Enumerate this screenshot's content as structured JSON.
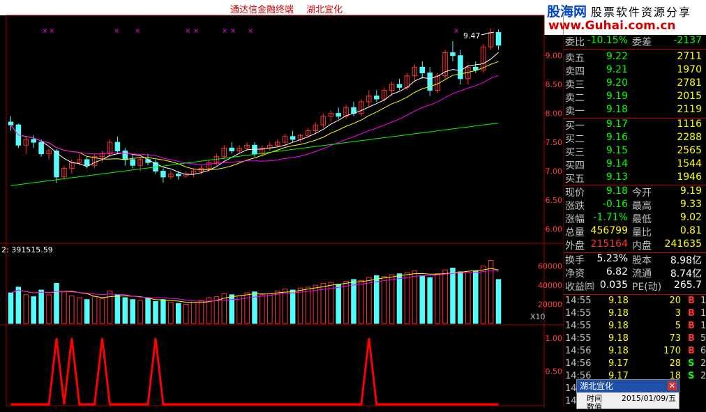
{
  "header": {
    "app_title": "通达信金融终端",
    "stock_name": "湖北宜化"
  },
  "logo": {
    "brand": "股海网",
    "tagline": "股票软件资源分享",
    "url": "www.Guhai.com.cn"
  },
  "price_axis": [
    "9.00",
    "8.50",
    "8.00",
    "7.50",
    "7.00",
    "6.50",
    "6.00"
  ],
  "volume_axis": [
    "60000",
    "40000",
    "20000"
  ],
  "volume_label": "2: 391515.59",
  "volume_unit": "X10",
  "signal_axis": [
    "1.00",
    "0.50"
  ],
  "high_marker": "9.47",
  "quote": {
    "webi_label": "委比",
    "webi_value": "-10.15%",
    "weicha_label": "委差",
    "weicha_value": "-2137",
    "asks": [
      {
        "label": "卖五",
        "price": "9.22",
        "vol": "2711"
      },
      {
        "label": "卖四",
        "price": "9.21",
        "vol": "1970"
      },
      {
        "label": "卖三",
        "price": "9.20",
        "vol": "2781"
      },
      {
        "label": "卖二",
        "price": "9.19",
        "vol": "2015"
      },
      {
        "label": "卖一",
        "price": "9.18",
        "vol": "2119"
      }
    ],
    "bids": [
      {
        "label": "买一",
        "price": "9.17",
        "vol": "1116"
      },
      {
        "label": "买二",
        "price": "9.16",
        "vol": "2288"
      },
      {
        "label": "买三",
        "price": "9.15",
        "vol": "2565"
      },
      {
        "label": "买四",
        "price": "9.14",
        "vol": "1544"
      },
      {
        "label": "买五",
        "price": "9.13",
        "vol": "1946"
      }
    ],
    "stats": [
      {
        "l1": "现价",
        "v1": "9.18",
        "c1": "green",
        "l2": "今开",
        "v2": "9.19",
        "c2": "yellow"
      },
      {
        "l1": "涨跌",
        "v1": "-0.16",
        "c1": "green",
        "l2": "最高",
        "v2": "9.33",
        "c2": "yellow"
      },
      {
        "l1": "涨幅",
        "v1": "-1.71%",
        "c1": "green",
        "l2": "最低",
        "v2": "9.02",
        "c2": "yellow"
      },
      {
        "l1": "总量",
        "v1": "456799",
        "c1": "yellow",
        "l2": "量比",
        "v2": "0.81",
        "c2": "yellow"
      },
      {
        "l1": "外盘",
        "v1": "215164",
        "c1": "red",
        "l2": "内盘",
        "v2": "241635",
        "c2": "yellow"
      }
    ],
    "fund": [
      {
        "l1": "换手",
        "v1": "5.23%",
        "l2": "股本",
        "v2": "8.98亿"
      },
      {
        "l1": "净资",
        "v1": "6.82",
        "l2": "流通",
        "v2": "8.74亿"
      },
      {
        "l1": "收益㈣",
        "v1": "0.035",
        "l2": "PE(动)",
        "v2": "265.7"
      }
    ],
    "ticks": [
      {
        "t": "14:55",
        "p": "9.18",
        "q": "20",
        "d": "B",
        "c": "1"
      },
      {
        "t": "14:55",
        "p": "9.18",
        "q": "3",
        "d": "B",
        "c": "1"
      },
      {
        "t": "14:55",
        "p": "9.18",
        "q": "5",
        "d": "B",
        "c": "1"
      },
      {
        "t": "14:55",
        "p": "9.18",
        "q": "73",
        "d": "B",
        "c": "5"
      },
      {
        "t": "14:56",
        "p": "9.18",
        "q": "170",
        "d": "B",
        "c": "6"
      },
      {
        "t": "14:56",
        "p": "9.17",
        "q": "28",
        "d": "S",
        "c": "2"
      },
      {
        "t": "14:56",
        "p": "9.17",
        "q": "18",
        "d": "S",
        "c": "2"
      },
      {
        "t": "14",
        "p": "",
        "q": "",
        "d": "",
        "c": ""
      },
      {
        "t": "14",
        "p": "",
        "q": "",
        "d": "",
        "c": ""
      }
    ]
  },
  "popup": {
    "title": "湖北宜化",
    "time_label": "时间",
    "time_value": "2015/01/09/五",
    "next_label": "数值",
    "next_value": ""
  },
  "chart_data": {
    "type": "candlestick",
    "y_range": [
      5.8,
      9.6
    ],
    "candles": [
      [
        7.85,
        7.95,
        7.7,
        7.8
      ],
      [
        7.8,
        7.82,
        7.4,
        7.45
      ],
      [
        7.45,
        7.6,
        7.3,
        7.55
      ],
      [
        7.55,
        7.62,
        7.4,
        7.5
      ],
      [
        7.5,
        7.55,
        7.25,
        7.3
      ],
      [
        7.3,
        7.4,
        7.2,
        7.35
      ],
      [
        7.35,
        7.38,
        6.8,
        6.9
      ],
      [
        6.9,
        7.1,
        6.85,
        7.05
      ],
      [
        7.05,
        7.2,
        6.95,
        7.15
      ],
      [
        7.15,
        7.3,
        7.1,
        7.2
      ],
      [
        7.2,
        7.25,
        7.05,
        7.1
      ],
      [
        7.1,
        7.3,
        7.05,
        7.25
      ],
      [
        7.25,
        7.35,
        7.15,
        7.3
      ],
      [
        7.3,
        7.55,
        7.25,
        7.5
      ],
      [
        7.5,
        7.6,
        7.3,
        7.35
      ],
      [
        7.35,
        7.4,
        7.1,
        7.2
      ],
      [
        7.2,
        7.3,
        7.05,
        7.1
      ],
      [
        7.1,
        7.25,
        7.0,
        7.2
      ],
      [
        7.2,
        7.3,
        7.1,
        7.15
      ],
      [
        7.15,
        7.2,
        6.95,
        7.0
      ],
      [
        7.0,
        7.05,
        6.8,
        6.9
      ],
      [
        6.9,
        7.0,
        6.85,
        6.95
      ],
      [
        6.95,
        7.0,
        6.85,
        6.92
      ],
      [
        6.92,
        7.0,
        6.88,
        6.95
      ],
      [
        6.95,
        7.05,
        6.9,
        7.0
      ],
      [
        7.0,
        7.1,
        6.95,
        7.05
      ],
      [
        7.05,
        7.2,
        7.0,
        7.15
      ],
      [
        7.15,
        7.3,
        7.1,
        7.25
      ],
      [
        7.25,
        7.45,
        7.2,
        7.4
      ],
      [
        7.4,
        7.5,
        7.3,
        7.35
      ],
      [
        7.35,
        7.45,
        7.3,
        7.4
      ],
      [
        7.4,
        7.5,
        7.35,
        7.45
      ],
      [
        7.45,
        7.5,
        7.25,
        7.3
      ],
      [
        7.3,
        7.45,
        7.25,
        7.4
      ],
      [
        7.4,
        7.5,
        7.35,
        7.45
      ],
      [
        7.45,
        7.55,
        7.4,
        7.5
      ],
      [
        7.5,
        7.65,
        7.45,
        7.6
      ],
      [
        7.6,
        7.7,
        7.5,
        7.55
      ],
      [
        7.55,
        7.65,
        7.5,
        7.62
      ],
      [
        7.62,
        7.75,
        7.58,
        7.7
      ],
      [
        7.7,
        7.85,
        7.65,
        7.8
      ],
      [
        7.8,
        8.0,
        7.75,
        7.95
      ],
      [
        7.95,
        8.05,
        7.85,
        8.0
      ],
      [
        8.0,
        8.1,
        7.9,
        7.95
      ],
      [
        7.95,
        8.15,
        7.9,
        8.1
      ],
      [
        8.1,
        8.2,
        7.95,
        8.0
      ],
      [
        8.0,
        8.25,
        7.95,
        8.2
      ],
      [
        8.2,
        8.4,
        8.1,
        8.3
      ],
      [
        8.3,
        8.4,
        8.2,
        8.25
      ],
      [
        8.25,
        8.45,
        8.2,
        8.4
      ],
      [
        8.4,
        8.55,
        8.3,
        8.5
      ],
      [
        8.5,
        8.6,
        8.4,
        8.45
      ],
      [
        8.45,
        8.7,
        8.4,
        8.65
      ],
      [
        8.65,
        8.85,
        8.55,
        8.8
      ],
      [
        8.8,
        8.9,
        8.6,
        8.7
      ],
      [
        8.7,
        8.8,
        8.3,
        8.4
      ],
      [
        8.4,
        8.7,
        8.35,
        8.65
      ],
      [
        8.65,
        9.1,
        8.6,
        9.05
      ],
      [
        9.05,
        9.25,
        8.9,
        9.0
      ],
      [
        9.0,
        9.1,
        8.5,
        8.6
      ],
      [
        8.6,
        8.85,
        8.5,
        8.8
      ],
      [
        8.8,
        8.9,
        8.7,
        8.75
      ],
      [
        8.75,
        9.2,
        8.7,
        9.15
      ],
      [
        9.15,
        9.47,
        9.1,
        9.4
      ],
      [
        9.4,
        9.45,
        9.1,
        9.18
      ]
    ],
    "volumes": [
      32,
      38,
      30,
      28,
      35,
      30,
      42,
      33,
      29,
      27,
      25,
      28,
      26,
      34,
      30,
      27,
      25,
      24,
      26,
      23,
      25,
      22,
      21,
      20,
      22,
      24,
      27,
      28,
      31,
      30,
      29,
      32,
      33,
      30,
      31,
      34,
      36,
      35,
      37,
      38,
      40,
      42,
      43,
      41,
      44,
      46,
      45,
      48,
      50,
      49,
      51,
      52,
      53,
      55,
      50,
      48,
      52,
      56,
      58,
      54,
      53,
      55,
      60,
      66,
      46
    ]
  }
}
